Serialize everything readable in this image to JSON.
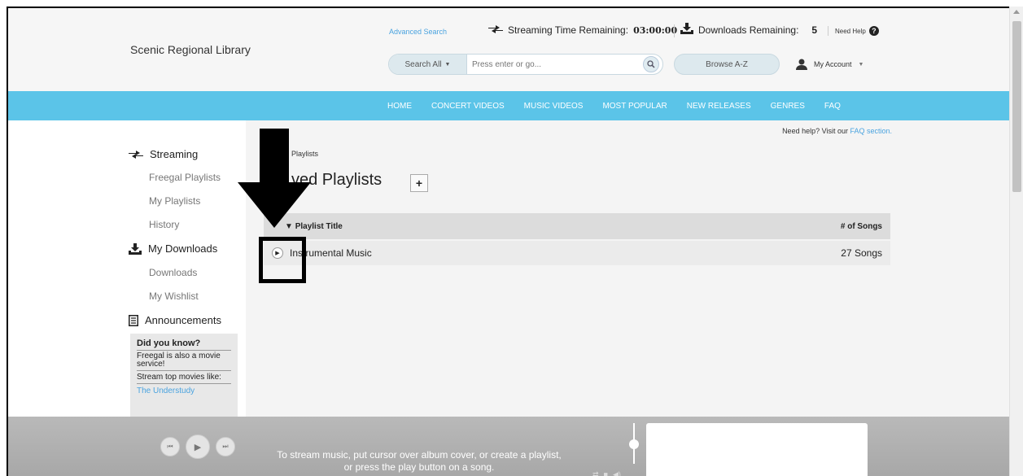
{
  "header": {
    "library_name": "Scenic Regional Library",
    "advanced_search": "Advanced Search",
    "streaming_label": "Streaming Time Remaining:",
    "streaming_value": "03:00:00",
    "downloads_label": "Downloads Remaining:",
    "downloads_value": "5",
    "need_help": "Need Help",
    "search_scope": "Search All",
    "search_placeholder": "Press enter or go...",
    "browse_label": "Browse A-Z",
    "account_label": "My Account"
  },
  "nav": {
    "items": [
      "HOME",
      "CONCERT VIDEOS",
      "MUSIC VIDEOS",
      "MOST POPULAR",
      "NEW RELEASES",
      "GENRES",
      "FAQ"
    ]
  },
  "sidebar": {
    "streaming": "Streaming",
    "freegal_playlists": "Freegal Playlists",
    "my_playlists": "My Playlists",
    "history": "History",
    "my_downloads": "My Downloads",
    "downloads": "Downloads",
    "my_wishlist": "My Wishlist",
    "announcements": "Announcements",
    "did_you_know": {
      "title": "Did you know?",
      "item1": "Freegal is also a movie service!",
      "item2": "Stream top movies like:",
      "link": "The Understudy"
    }
  },
  "main": {
    "faq_help_prefix": "Need help? Visit our",
    "faq_help_link": "FAQ section.",
    "breadcrumb": "Playlists",
    "title": "ved Playlists",
    "add_label": "+",
    "table": {
      "col_title": "Playlist Title",
      "col_songs": "# of Songs",
      "rows": [
        {
          "title": "Instrumental Music",
          "songs": "27 Songs"
        }
      ]
    }
  },
  "player": {
    "message_line1": "To stream music, put cursor over album cover, or create a playlist,",
    "message_line2": "or press the play button on a song."
  },
  "icons": {
    "streaming": "streaming-arrows-icon",
    "download": "download-icon",
    "help": "help-circle-icon",
    "search": "search-icon",
    "user": "user-icon",
    "announcements": "document-icon",
    "play": "play-icon"
  },
  "colors": {
    "nav_bg": "#5bc4e8",
    "link": "#4aa3df",
    "player_bg": "#b0b0b0"
  }
}
